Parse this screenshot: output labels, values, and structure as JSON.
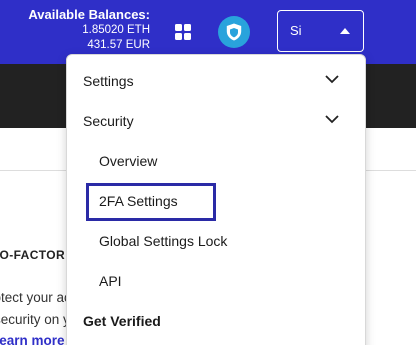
{
  "header": {
    "balances_title": "Available Balances:",
    "balance_eth": "1.85020 ETH",
    "balance_eur": "431.57 EUR",
    "account_button_label": "Sign in"
  },
  "background": {
    "section_heading": "TWO-FACTOR AUTHENTICATION",
    "body_line_1": "Protect your account",
    "body_line_2": "security on your",
    "learn_more_link": "Learn more"
  },
  "menu": {
    "settings": "Settings",
    "security": "Security",
    "overview": "Overview",
    "twofa": "2FA Settings",
    "global_lock": "Global Settings Lock",
    "api": "API",
    "get_verified": "Get Verified"
  },
  "icons": {
    "apps": "grid-icon",
    "security": "shield-icon",
    "account_caret": "caret-up-icon",
    "expand": "chevron-down-icon"
  },
  "colors": {
    "header_bg": "#2f2fc8",
    "shield_bg": "#29a3dc",
    "focus_outline": "#2a2aa6",
    "dark_band": "#222222"
  }
}
